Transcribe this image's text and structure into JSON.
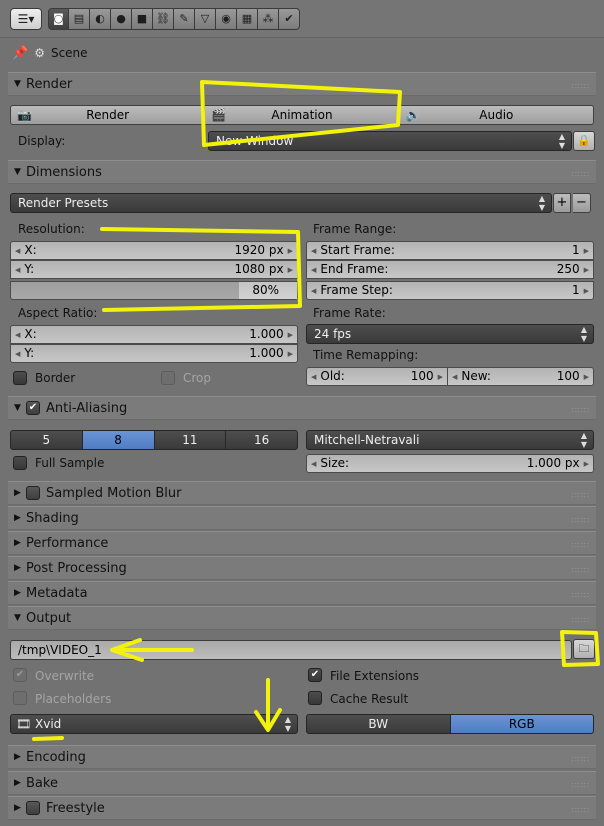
{
  "toolbar": {
    "editor_icon": "properties-editor-icon",
    "tabs": [
      {
        "icon": "render-icon",
        "glyph": "◙",
        "active": true
      },
      {
        "icon": "render-layers-icon",
        "glyph": "▤"
      },
      {
        "icon": "scene-icon",
        "glyph": "◐"
      },
      {
        "icon": "world-icon",
        "glyph": "●"
      },
      {
        "icon": "object-icon",
        "glyph": "■"
      },
      {
        "icon": "constraints-icon",
        "glyph": "⛓"
      },
      {
        "icon": "modifier-wrench-icon",
        "glyph": "✎"
      },
      {
        "icon": "data-vertex-icon",
        "glyph": "▽"
      },
      {
        "icon": "material-icon",
        "glyph": "◉"
      },
      {
        "icon": "texture-icon",
        "glyph": "▦"
      },
      {
        "icon": "particles-icon",
        "glyph": "⁂"
      },
      {
        "icon": "physics-icon",
        "glyph": "✔"
      }
    ]
  },
  "context": {
    "scene_label": "Scene"
  },
  "render": {
    "header": "Render",
    "buttons": [
      "Render",
      "Animation",
      "Audio"
    ],
    "display_label": "Display:",
    "display_value": "New Window"
  },
  "dimensions": {
    "header": "Dimensions",
    "presets": "Render Presets",
    "resolution_label": "Resolution:",
    "res_x_label": "X:",
    "res_x_value": "1920 px",
    "res_y_label": "Y:",
    "res_y_value": "1080 px",
    "res_percent": "80%",
    "aspect_label": "Aspect Ratio:",
    "aspect_x_label": "X:",
    "aspect_x_value": "1.000",
    "aspect_y_label": "Y:",
    "aspect_y_value": "1.000",
    "border_label": "Border",
    "crop_label": "Crop",
    "frame_range_label": "Frame Range:",
    "start_label": "Start Frame:",
    "start_value": "1",
    "end_label": "End Frame:",
    "end_value": "250",
    "step_label": "Frame Step:",
    "step_value": "1",
    "frame_rate_label": "Frame Rate:",
    "frame_rate_value": "24 fps",
    "remap_label": "Time Remapping:",
    "old_label": "Old:",
    "old_value": "100",
    "new_label": "New:",
    "new_value": "100"
  },
  "antialiasing": {
    "header": "Anti-Aliasing",
    "samples": [
      "5",
      "8",
      "11",
      "16"
    ],
    "active_sample": "8",
    "filter": "Mitchell-Netravali",
    "full_sample_label": "Full Sample",
    "size_label": "Size:",
    "size_value": "1.000 px"
  },
  "collapsed_panels": {
    "motion_blur": "Sampled Motion Blur",
    "shading": "Shading",
    "performance": "Performance",
    "post_processing": "Post Processing",
    "metadata": "Metadata"
  },
  "output": {
    "header": "Output",
    "path": "/tmp\\VIDEO_1",
    "overwrite_label": "Overwrite",
    "placeholders_label": "Placeholders",
    "file_extensions_label": "File Extensions",
    "cache_result_label": "Cache Result",
    "format": "Xvid",
    "color_modes": [
      "BW",
      "RGB"
    ],
    "active_color_mode": "RGB"
  },
  "bottom_panels": {
    "encoding": "Encoding",
    "bake": "Bake",
    "freestyle": "Freestyle"
  },
  "colors": {
    "panel_bg": "#727272",
    "accent_blue": "#5a86cc",
    "annotation_yellow": "#f2f20c"
  }
}
